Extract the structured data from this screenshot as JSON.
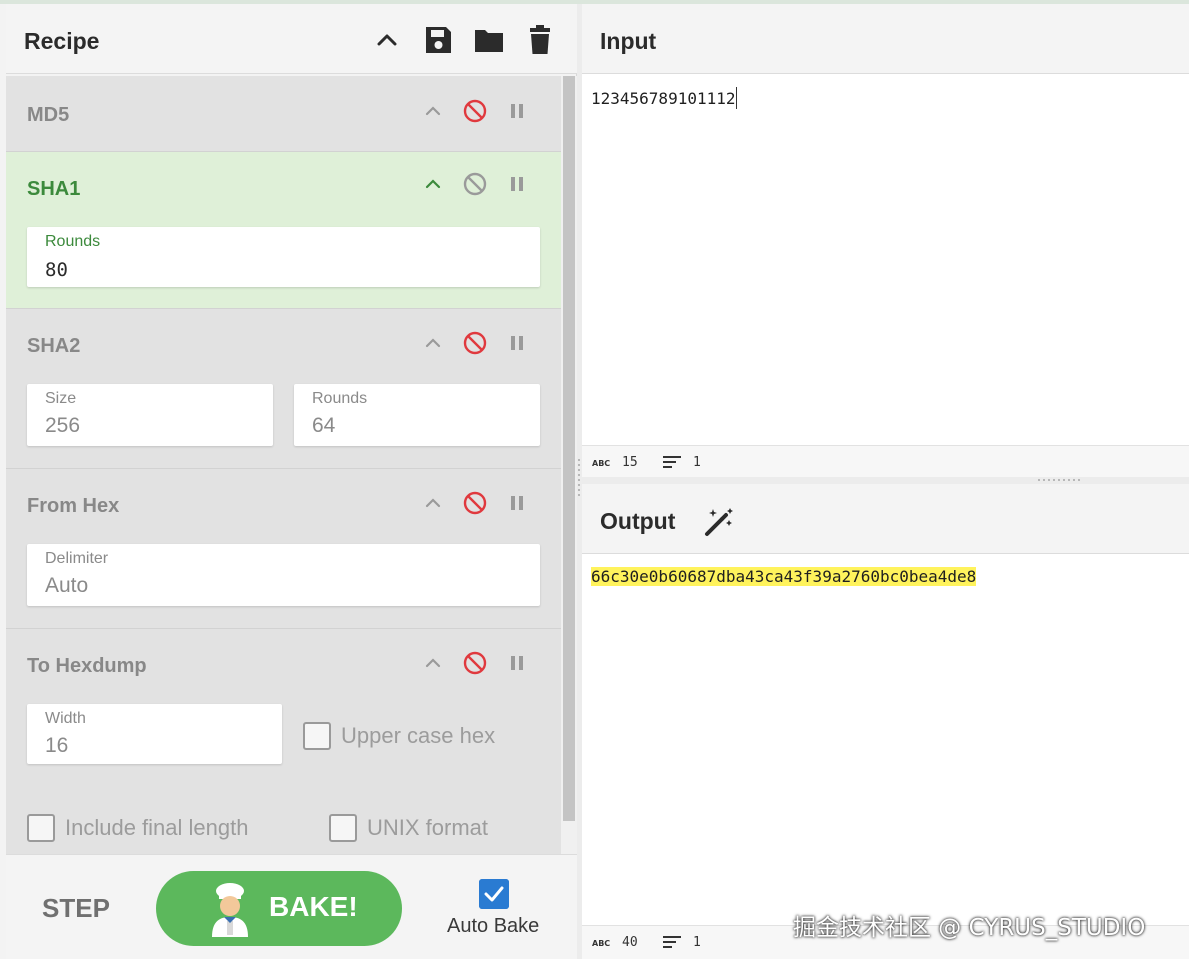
{
  "recipe": {
    "title": "Recipe",
    "operations": [
      {
        "name": "MD5",
        "state": "disabled",
        "args": []
      },
      {
        "name": "SHA1",
        "state": "active",
        "args": [
          {
            "label": "Rounds",
            "value": "80"
          }
        ]
      },
      {
        "name": "SHA2",
        "state": "disabled",
        "args": [
          {
            "label": "Size",
            "value": "256"
          },
          {
            "label": "Rounds",
            "value": "64"
          }
        ]
      },
      {
        "name": "From Hex",
        "state": "disabled",
        "args": [
          {
            "label": "Delimiter",
            "value": "Auto"
          }
        ]
      },
      {
        "name": "To Hexdump",
        "state": "disabled",
        "args": [
          {
            "label": "Width",
            "value": "16"
          }
        ],
        "options": [
          {
            "label": "Upper case hex",
            "checked": false
          },
          {
            "label": "Include final length",
            "checked": false
          },
          {
            "label": "UNIX format",
            "checked": false
          }
        ]
      }
    ]
  },
  "controls": {
    "step_label": "STEP",
    "bake_label": "BAKE!",
    "auto_bake_label": "Auto Bake",
    "auto_bake_checked": true
  },
  "input": {
    "title": "Input",
    "text": "123456789101112",
    "status": {
      "length": "15",
      "lines": "1"
    }
  },
  "output": {
    "title": "Output",
    "text": "66c30e0b60687dba43ca43f39a2760bc0bea4de8",
    "status": {
      "length": "40",
      "lines": "1"
    }
  },
  "watermark": "掘金技术社区 @ CYRUS_STUDIO",
  "colors": {
    "active_op_bg": "#dff0d8",
    "active_op_text": "#3c8a3c",
    "disable_icon": "#e0393e",
    "bake_button": "#5cb85c",
    "output_highlight": "#fff35c",
    "auto_bake_check": "#2a7bd2"
  },
  "icons": {
    "header": [
      "chevron-up-icon",
      "save-icon",
      "folder-icon",
      "trash-icon"
    ],
    "op_controls": [
      "chevron-up-icon",
      "disable-icon",
      "pause-icon"
    ],
    "output": "magic-wand-icon",
    "status": [
      "abc-icon",
      "lines-icon"
    ],
    "bake": "chef-icon"
  }
}
